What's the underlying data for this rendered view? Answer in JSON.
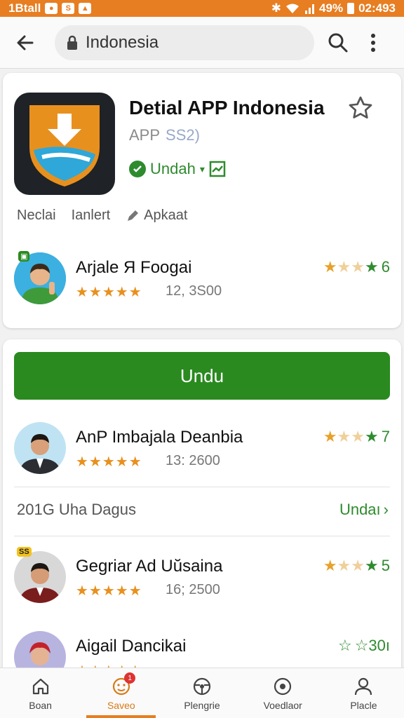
{
  "status_bar": {
    "carrier": "1Btall",
    "battery": "49%",
    "time": "02:493"
  },
  "search": {
    "query": "Indonesia"
  },
  "app": {
    "title": "Detial APP Indonesia",
    "sub_label": "APP",
    "version": "SS2)",
    "installed_label": "Undah",
    "tabs": [
      "Neclai",
      "Ianlert",
      "Apkaat"
    ]
  },
  "featured_rows": [
    {
      "name": "Arjale Я Foogai",
      "count": "12, 3S00",
      "rating": "6",
      "badge": ""
    },
    {
      "name": "AnP Imbajala Deanbia",
      "count": "13: 2600",
      "rating": "7",
      "badge": ""
    },
    {
      "name": "Gegriar Ad Uŭsaina",
      "count": "16; 2500",
      "rating": "5",
      "badge": "SS"
    },
    {
      "name": "Aigail Dancikai",
      "count": "",
      "rating": "☆30ı",
      "badge": ""
    }
  ],
  "install_button": "Undu",
  "section": {
    "title": "201G Uha Dagus",
    "link": "Undaı"
  },
  "bottom_nav": [
    {
      "label": "Boan",
      "icon": "home-icon"
    },
    {
      "label": "Saveo",
      "icon": "face-icon",
      "badge": "1"
    },
    {
      "label": "Plengrie",
      "icon": "steering-icon"
    },
    {
      "label": "Voedlaor",
      "icon": "record-icon"
    },
    {
      "label": "Placle",
      "icon": "person-icon"
    }
  ],
  "colors": {
    "accent": "#e77e22",
    "green": "#2a8a1f",
    "star": "#e8901e"
  }
}
